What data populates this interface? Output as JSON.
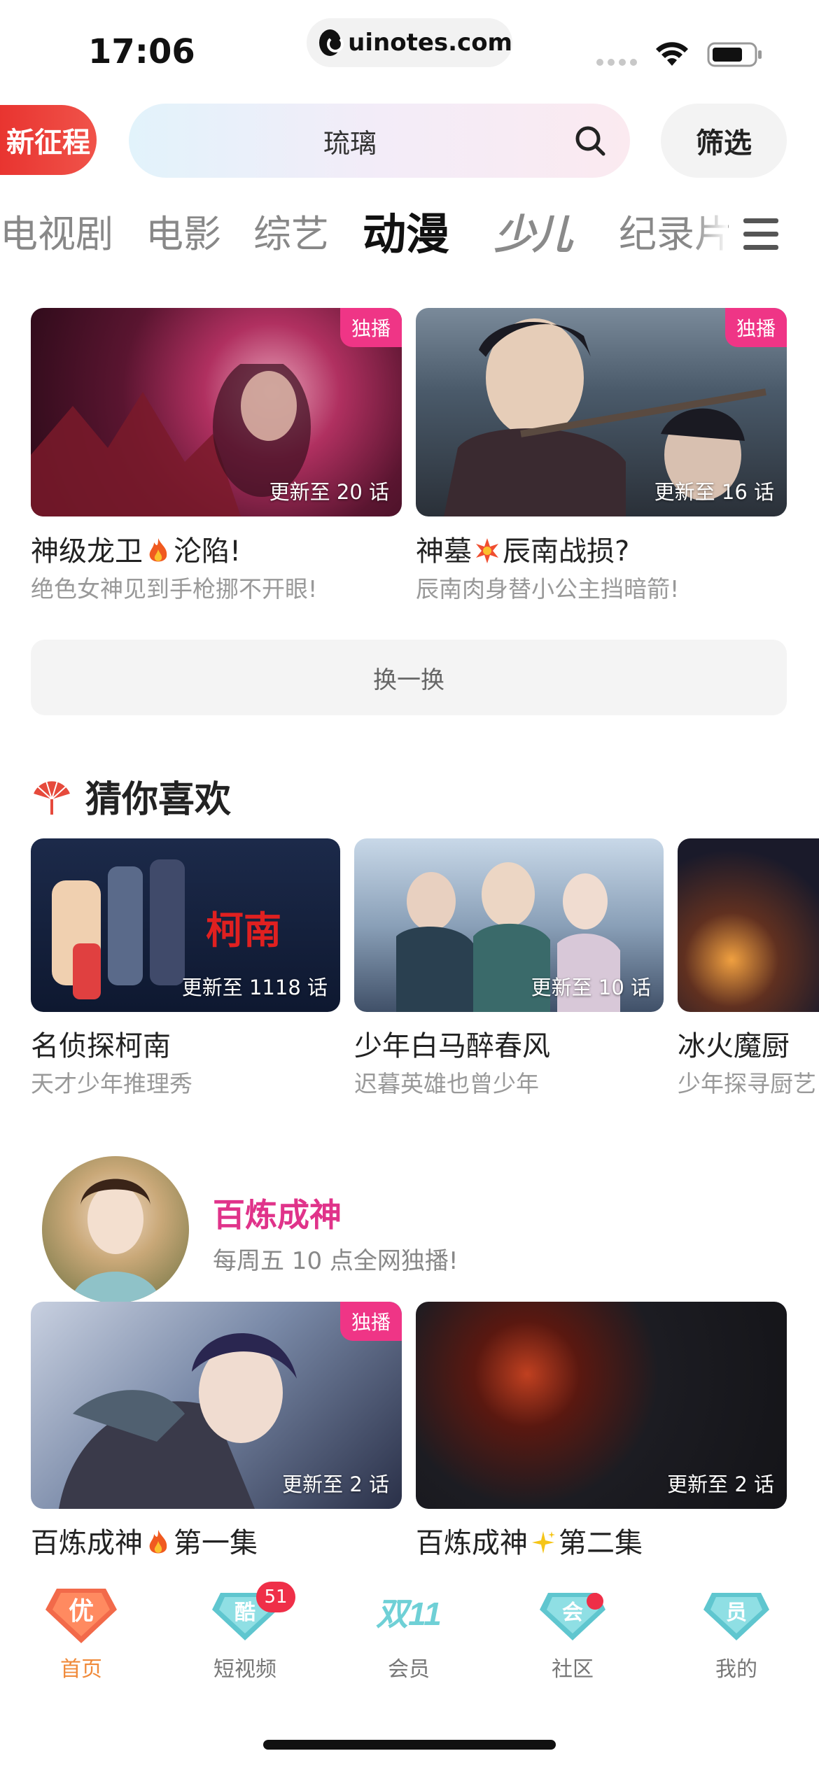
{
  "status_bar": {
    "time": "17:06",
    "url": "uinotes.com"
  },
  "header": {
    "promo_label": "新征程",
    "search_text": "琉璃",
    "filter_label": "筛选"
  },
  "tabs": [
    "电视剧",
    "电影",
    "综艺",
    "动漫",
    "少儿",
    "纪录片"
  ],
  "active_tab": "动漫",
  "featured": [
    {
      "badge": "独播",
      "update": "更新至 20 话",
      "title_a": "神级龙卫",
      "title_b": "沦陷!",
      "subtitle": "绝色女神见到手枪挪不开眼!",
      "icon": "fire-icon"
    },
    {
      "badge": "独播",
      "update": "更新至 16 话",
      "title_a": "神墓",
      "title_b": "辰南战损?",
      "subtitle": "辰南肉身替小公主挡暗箭!",
      "icon": "explosion-icon"
    }
  ],
  "swap_label": "换一换",
  "guess_section": {
    "title": "猜你喜欢",
    "items": [
      {
        "update": "更新至 1118 话",
        "title": "名侦探柯南",
        "subtitle": "天才少年推理秀"
      },
      {
        "update": "更新至 10 话",
        "title": "少年白马醉春风",
        "subtitle": "迟暮英雄也曾少年"
      },
      {
        "update": "",
        "title": "冰火魔厨",
        "subtitle": "少年探寻厨艺"
      }
    ]
  },
  "promo_section": {
    "title": "百炼成神",
    "subtitle": "每周五 10 点全网独播!",
    "items": [
      {
        "badge": "独播",
        "update": "更新至 2 话",
        "title_a": "百炼成神",
        "title_b": "第一集",
        "icon": "fire-icon"
      },
      {
        "badge": "",
        "update": "更新至 2 话",
        "title_a": "百炼成神",
        "title_b": "第二集",
        "icon": "sparkles-icon"
      }
    ]
  },
  "bottom_nav": [
    {
      "label": "首页",
      "glyph": "优",
      "active": true
    },
    {
      "label": "短视频",
      "glyph": "酷",
      "count": "51"
    },
    {
      "label": "会员",
      "glyph": "双11"
    },
    {
      "label": "社区",
      "glyph": "会",
      "dot": true
    },
    {
      "label": "我的",
      "glyph": "员"
    }
  ],
  "colors": {
    "accent_pink": "#ef3586",
    "accent_orange": "#f08a3a",
    "promo_red": "#e8322e"
  }
}
